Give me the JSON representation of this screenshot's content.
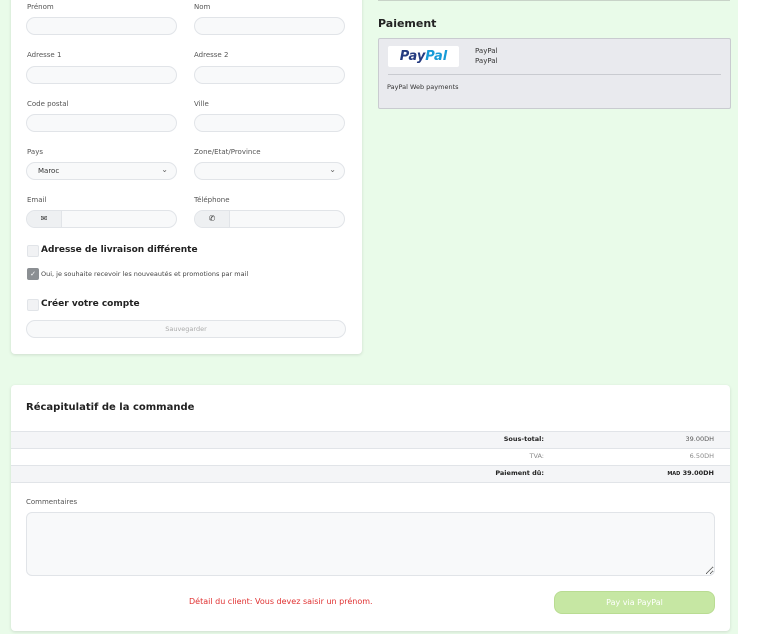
{
  "form": {
    "firstname": {
      "label": "Prénom",
      "value": ""
    },
    "lastname": {
      "label": "Nom",
      "value": ""
    },
    "address1": {
      "label": "Adresse 1",
      "value": ""
    },
    "address2": {
      "label": "Adresse 2",
      "value": ""
    },
    "postcode": {
      "label": "Code postal",
      "value": ""
    },
    "city": {
      "label": "Ville",
      "value": ""
    },
    "country": {
      "label": "Pays",
      "value": "Maroc"
    },
    "zone": {
      "label": "Zone/Etat/Province",
      "value": ""
    },
    "email": {
      "label": "Email",
      "value": "",
      "icon": "envelope-icon"
    },
    "phone": {
      "label": "Téléphone",
      "value": "",
      "icon": "phone-icon"
    },
    "different_shipping": {
      "label": "Adresse de livraison différente",
      "checked": false
    },
    "newsletter": {
      "label": "Oui, je souhaite recevoir les nouveautés et promotions par mail",
      "checked": true
    },
    "create_account": {
      "label": "Créer votre compte",
      "checked": false
    },
    "save_label": "Sauvegarder"
  },
  "payment": {
    "title": "Paiement",
    "method": {
      "logo_text_1": "Pay",
      "logo_text_2": "Pal",
      "name": "PayPal",
      "subname": "PayPal",
      "description": "PayPal Web payments"
    }
  },
  "summary": {
    "title": "Récapitulatif de la commande",
    "rows": [
      {
        "label": "Sous-total:",
        "value": "39.00DH"
      },
      {
        "label": "TVA:",
        "value": "6.50DH"
      },
      {
        "label": "Paiement dû:",
        "currency": "MAD",
        "value": "39.00DH"
      }
    ],
    "comments_label": "Commentaires",
    "comments_value": "",
    "error": "Détail du client: Vous devez saisir un prénom.",
    "pay_button": "Pay via PayPal"
  },
  "colors": {
    "background": "#e9fbe9",
    "error": "#e03131",
    "pay_button": "#c6e7a3",
    "paypal_dark": "#253b80",
    "paypal_light": "#179bd7"
  }
}
